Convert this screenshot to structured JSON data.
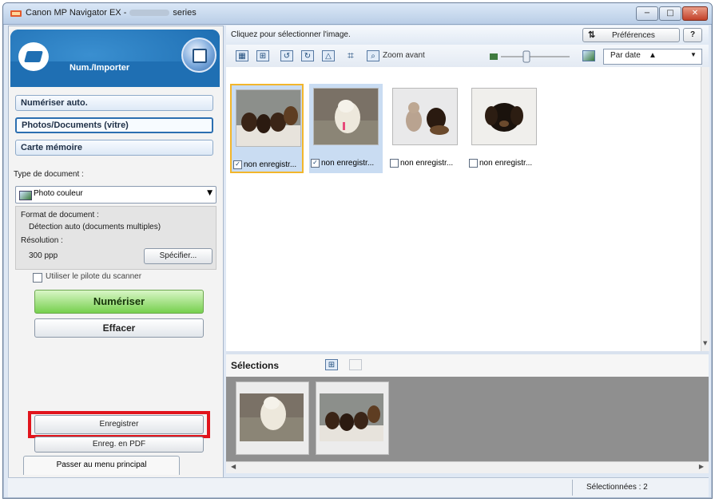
{
  "window": {
    "title_prefix": "Canon MP Navigator EX -",
    "title_suffix": "series",
    "controls": [
      "−",
      "□",
      "✕"
    ]
  },
  "left_panel": {
    "header_title": "Num./Importer",
    "nav": [
      "Numériser auto.",
      "Photos/Documents (vitre)",
      "Carte mémoire"
    ],
    "doc_type_label": "Type de document :",
    "doc_type_value": "Photo couleur",
    "format_label": "Format de document :",
    "format_value": "Détection auto (documents multiples)",
    "resolution_label": "Résolution :",
    "resolution_value": "300 ppp",
    "specify_button": "Spécifier...",
    "driver_checkbox": "Utiliser le pilote du scanner",
    "scan_button": "Numériser",
    "clear_button": "Effacer",
    "save_button": "Enregistrer",
    "save_pdf_button": "Enreg. en PDF",
    "main_menu_button": "Passer au menu principal"
  },
  "right_panel": {
    "instruction": "Cliquez pour sélectionner l'image.",
    "preferences_button": "Préférences",
    "help_button": "?",
    "zoom_label": "Zoom avant",
    "sort_value": "Par date",
    "sort_arrow": "▲",
    "thumbnails": [
      {
        "caption": "non enregistr...",
        "checked": true
      },
      {
        "caption": "non enregistr...",
        "checked": true
      },
      {
        "caption": "non enregistr...",
        "checked": false
      },
      {
        "caption": "non enregistr...",
        "checked": false
      }
    ],
    "selections_title": "Sélections"
  },
  "status_bar": {
    "selected_text": "Sélectionnées : 2"
  },
  "colors": {
    "accent": "#1f6fb3",
    "highlight": "#e1141c",
    "scan_green": "#76d04e"
  }
}
